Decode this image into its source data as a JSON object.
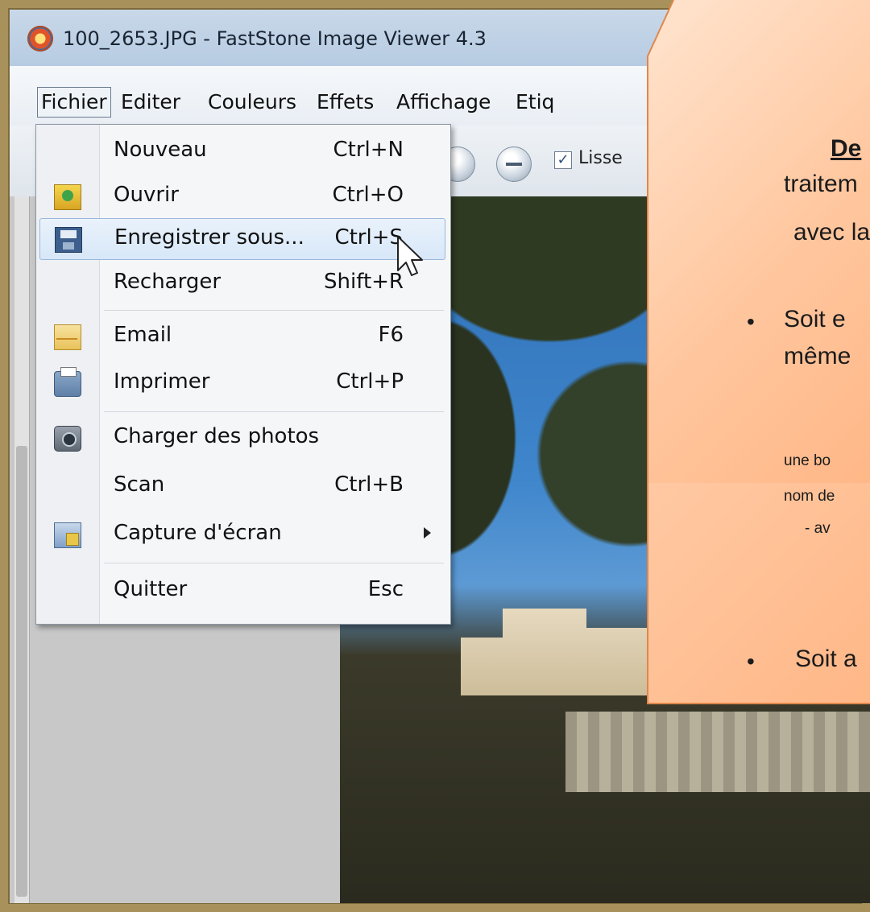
{
  "window": {
    "title": "100_2653.JPG  -  FastStone Image Viewer 4.3"
  },
  "menubar": {
    "items": [
      "Fichier",
      "Editer",
      "Couleurs",
      "Effets",
      "Affichage",
      "Etiq"
    ]
  },
  "toolbar": {
    "smooth_label": "Lisse",
    "smooth_checked": "✓"
  },
  "dropdown": {
    "items": [
      {
        "label": "Nouveau",
        "shortcut": "Ctrl+N"
      },
      {
        "label": "Ouvrir",
        "shortcut": "Ctrl+O"
      },
      {
        "label": "Enregistrer sous...",
        "shortcut": "Ctrl+S"
      },
      {
        "label": "Recharger",
        "shortcut": "Shift+R"
      },
      {
        "label": "Email",
        "shortcut": "F6"
      },
      {
        "label": "Imprimer",
        "shortcut": "Ctrl+P"
      },
      {
        "label": "Charger des photos",
        "shortcut": ""
      },
      {
        "label": "Scan",
        "shortcut": "Ctrl+B"
      },
      {
        "label": "Capture d'écran",
        "shortcut": ""
      },
      {
        "label": "Quitter",
        "shortcut": "Esc"
      }
    ]
  },
  "callout": {
    "line1": "De",
    "line2": "traitem",
    "line3": "avec la",
    "bullet1_a": "Soit e",
    "bullet1_b": "même",
    "note1": "une bo",
    "note2": "nom de",
    "note3": "- av",
    "bullet2": "Soit a",
    "bullet_symbol": "•"
  },
  "colors": {
    "callout_fill": "#ffc79f",
    "frame": "#a8915a",
    "menu_highlight": "#d7e7f8"
  }
}
